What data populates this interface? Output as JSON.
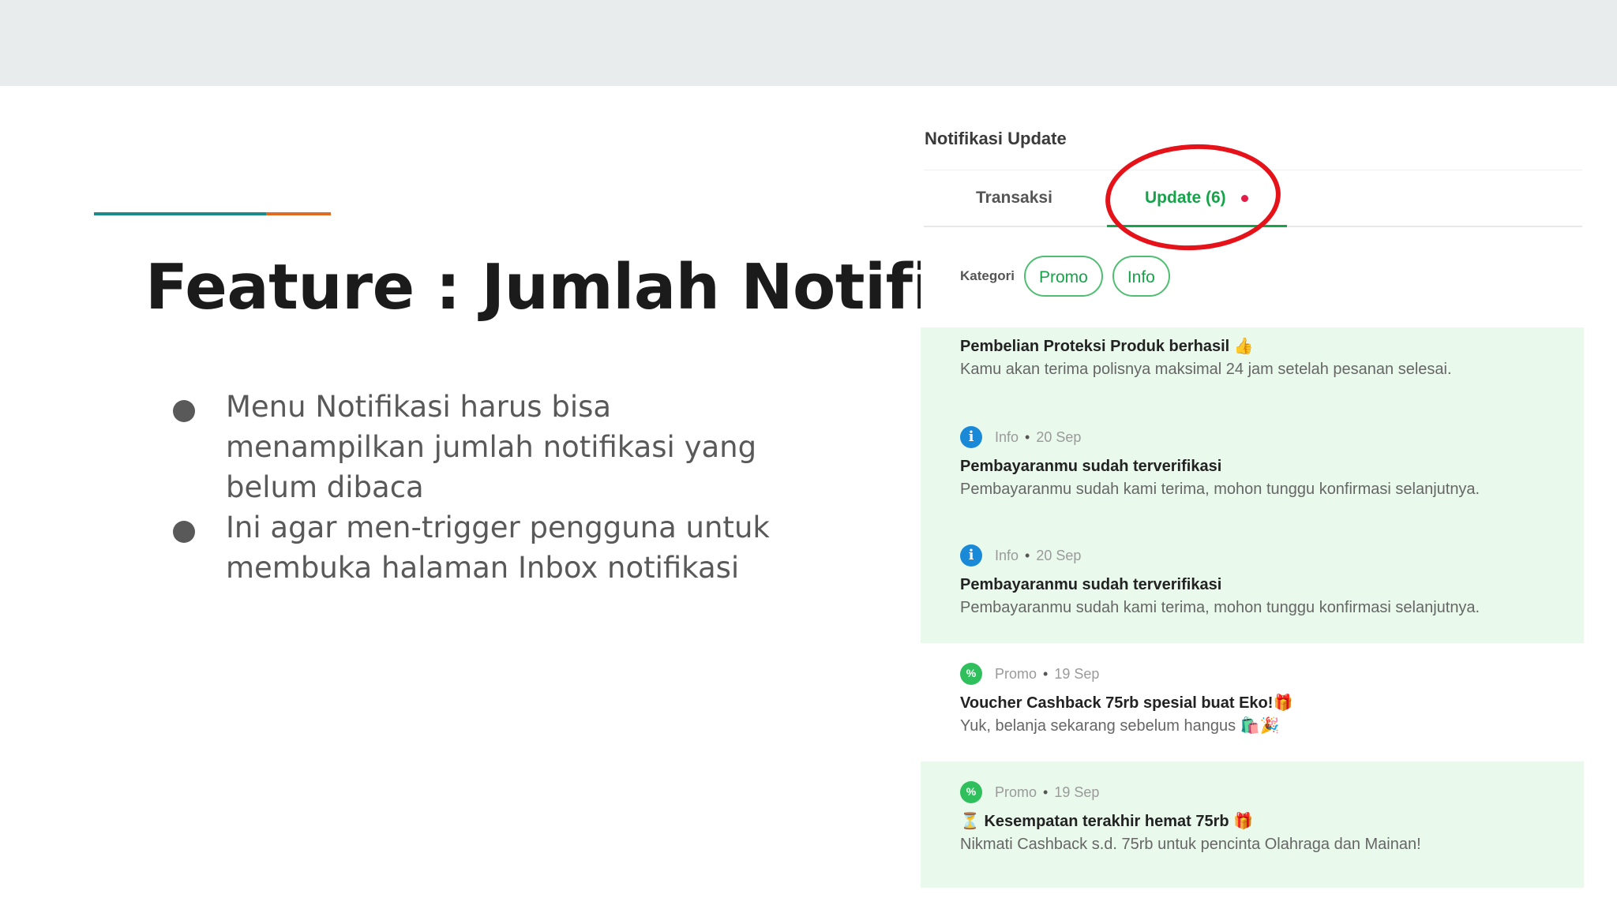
{
  "slide": {
    "title": "Feature : Jumlah Notifikasi",
    "bullets": [
      "Menu Notifikasi harus bisa menampilkan jumlah notifikasi yang belum dibaca",
      "Ini agar men-trigger pengguna untuk membuka halaman Inbox notifikasi"
    ],
    "colors": {
      "accent_teal": "#1b8c8a",
      "accent_orange": "#e06a21",
      "highlight_ring": "#e5121a"
    }
  },
  "panel": {
    "title": "Notifikasi Update",
    "tabs": {
      "transaksi": "Transaksi",
      "update": "Update (6)"
    },
    "filter_label": "Kategori",
    "chips": [
      "Promo",
      "Info"
    ],
    "items": [
      {
        "title": "Pembelian Proteksi Produk berhasil",
        "title_emoji": "👍",
        "desc": "Kamu akan terima polisnya maksimal 24 jam setelah pesanan selesai."
      },
      {
        "category": "Info",
        "date": "20 Sep",
        "icon": "info-icon",
        "title": "Pembayaranmu sudah terverifikasi",
        "desc": "Pembayaranmu sudah kami terima, mohon tunggu konfirmasi selanjutnya."
      },
      {
        "category": "Info",
        "date": "20 Sep",
        "icon": "info-icon",
        "title": "Pembayaranmu sudah terverifikasi",
        "desc": "Pembayaranmu sudah kami terima, mohon tunggu konfirmasi selanjutnya."
      },
      {
        "category": "Promo",
        "date": "19 Sep",
        "icon": "promo-badge-icon",
        "title": "Voucher Cashback 75rb spesial buat Eko!",
        "title_emoji": "🎁",
        "desc": "Yuk, belanja sekarang sebelum hangus",
        "desc_emoji": "🛍️🎉"
      },
      {
        "category": "Promo",
        "date": "19 Sep",
        "icon": "promo-badge-icon",
        "title_prefix": "⏳",
        "title": "Kesempatan terakhir hemat 75rb",
        "title_emoji": "🎁",
        "desc": "Nikmati Cashback s.d. 75rb untuk pencinta Olahraga dan Mainan!"
      }
    ]
  }
}
